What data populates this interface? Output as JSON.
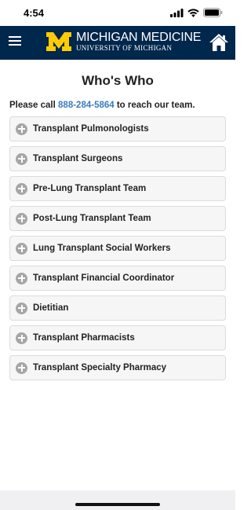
{
  "status": {
    "time": "4:54"
  },
  "header": {
    "brand_name": "MICHIGAN MEDICINE",
    "brand_sub": "UNIVERSITY OF MICHIGAN",
    "brand_color": "#00274c",
    "logo_color": "#ffcb05"
  },
  "page": {
    "title": "Who's Who",
    "intro_prefix": "Please call ",
    "phone": "888-284-5864",
    "intro_suffix": " to reach our team."
  },
  "sections": [
    {
      "label": "Transplant Pulmonologists",
      "icon": "plus-circle-icon"
    },
    {
      "label": "Transplant Surgeons",
      "icon": "plus-circle-icon"
    },
    {
      "label": "Pre-Lung Transplant Team",
      "icon": "plus-circle-icon"
    },
    {
      "label": "Post-Lung Transplant Team",
      "icon": "plus-circle-icon"
    },
    {
      "label": "Lung Transplant Social Workers",
      "icon": "plus-circle-icon"
    },
    {
      "label": "Transplant Financial Coordinator",
      "icon": "plus-circle-icon"
    },
    {
      "label": "Dietitian",
      "icon": "plus-circle-icon"
    },
    {
      "label": "Transplant Pharmacists",
      "icon": "plus-circle-icon"
    },
    {
      "label": "Transplant Specialty Pharmacy",
      "icon": "plus-circle-icon"
    }
  ]
}
